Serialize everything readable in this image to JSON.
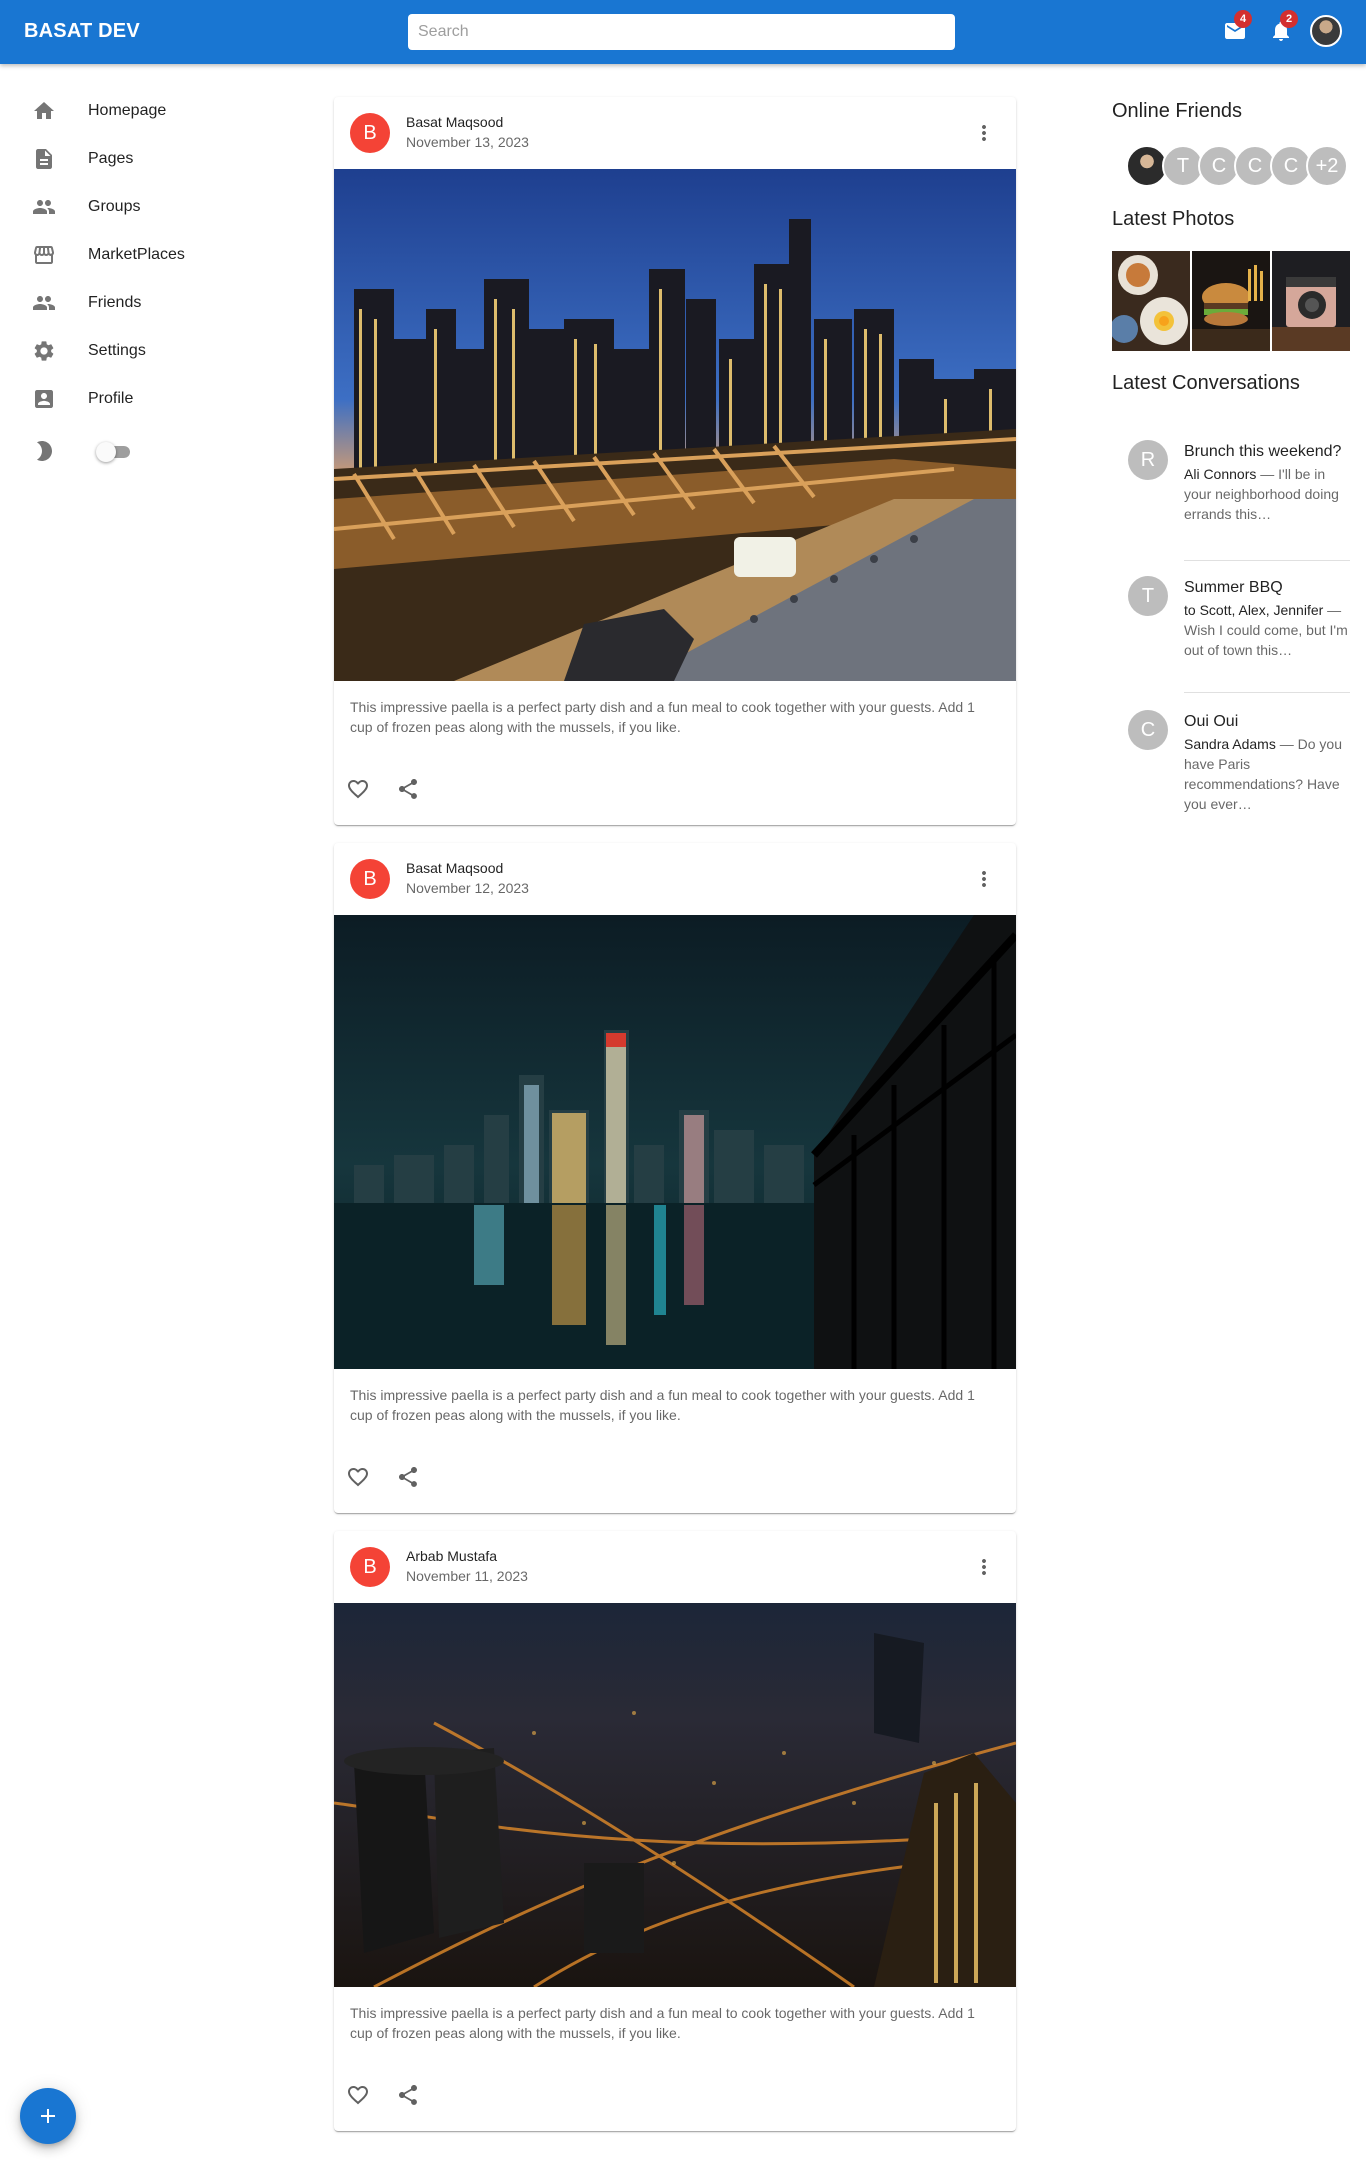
{
  "appbar": {
    "brand": "BASAT DEV",
    "search_placeholder": "Search",
    "mail_count": "4",
    "notification_count": "2"
  },
  "sidebar": {
    "items": [
      {
        "label": "Homepage",
        "icon": "home-icon"
      },
      {
        "label": "Pages",
        "icon": "article-icon"
      },
      {
        "label": "Groups",
        "icon": "group-icon"
      },
      {
        "label": "MarketPlaces",
        "icon": "storefront-icon"
      },
      {
        "label": "Friends",
        "icon": "person-icon"
      },
      {
        "label": "Settings",
        "icon": "settings-icon"
      },
      {
        "label": "Profile",
        "icon": "account-box-icon"
      }
    ],
    "dark_mode_on": false
  },
  "posts": [
    {
      "avatar_letter": "B",
      "author": "Basat Maqsood",
      "date": "November 13, 2023",
      "text": "This impressive paella is a perfect party dish and a fun meal to cook together with your guests. Add 1 cup of frozen peas along with the mussels, if you like."
    },
    {
      "avatar_letter": "B",
      "author": "Basat Maqsood",
      "date": "November 12, 2023",
      "text": "This impressive paella is a perfect party dish and a fun meal to cook together with your guests. Add 1 cup of frozen peas along with the mussels, if you like."
    },
    {
      "avatar_letter": "B",
      "author": "Arbab Mustafa",
      "date": "November 11, 2023",
      "text": "This impressive paella is a perfect party dish and a fun meal to cook together with your guests. Add 1 cup of frozen peas along with the mussels, if you like."
    }
  ],
  "right_panel": {
    "online_friends_title": "Online Friends",
    "friends": [
      "T",
      "C",
      "C",
      "C"
    ],
    "friends_more": "+2",
    "latest_photos_title": "Latest Photos",
    "latest_conversations_title": "Latest Conversations",
    "conversations": [
      {
        "letter": "R",
        "title": "Brunch this weekend?",
        "who": "Ali Connors",
        "snippet": " — I'll be in your neighborhood doing errands this…"
      },
      {
        "letter": "T",
        "title": "Summer BBQ",
        "who": "to Scott, Alex, Jennifer",
        "snippet": " — Wish I could come, but I'm out of town this…"
      },
      {
        "letter": "C",
        "title": "Oui Oui",
        "who": "Sandra Adams",
        "snippet": " — Do you have Paris recommendations? Have you ever…"
      }
    ]
  },
  "colors": {
    "primary": "#1976d2",
    "avatar_red": "#f44336",
    "badge_red": "#d32f2f"
  }
}
